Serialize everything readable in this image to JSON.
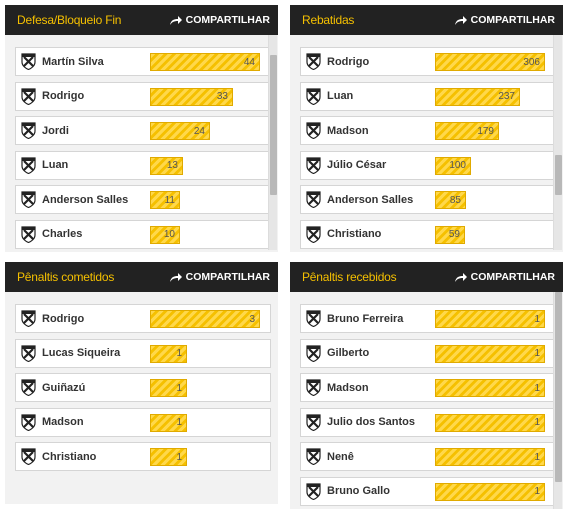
{
  "share_label": "COMPARTILHAR",
  "accent_color": "#f5c000",
  "icons": {
    "share": "share-arrow-icon",
    "crest": "vasco-crest-icon"
  },
  "panels": [
    {
      "title": "Defesa/Bloqueio Fin",
      "max": 44,
      "rows": [
        {
          "name": "Martín Silva",
          "value": 44
        },
        {
          "name": "Rodrigo",
          "value": 33
        },
        {
          "name": "Jordi",
          "value": 24
        },
        {
          "name": "Luan",
          "value": 13
        },
        {
          "name": "Anderson Salles",
          "value": 11
        },
        {
          "name": "Charles",
          "value": 10
        }
      ]
    },
    {
      "title": "Rebatidas",
      "max": 306,
      "rows": [
        {
          "name": "Rodrigo",
          "value": 306
        },
        {
          "name": "Luan",
          "value": 237
        },
        {
          "name": "Madson",
          "value": 179
        },
        {
          "name": "Júlio César",
          "value": 100
        },
        {
          "name": "Anderson Salles",
          "value": 85
        },
        {
          "name": "Christiano",
          "value": 59
        }
      ]
    },
    {
      "title": "Pênaltis cometidos",
      "max": 3,
      "rows": [
        {
          "name": "Rodrigo",
          "value": 3
        },
        {
          "name": "Lucas Siqueira",
          "value": 1
        },
        {
          "name": "Guiñazú",
          "value": 1
        },
        {
          "name": "Madson",
          "value": 1
        },
        {
          "name": "Christiano",
          "value": 1
        }
      ]
    },
    {
      "title": "Pênaltis recebidos",
      "max": 1,
      "rows": [
        {
          "name": "Bruno Ferreira",
          "value": 1
        },
        {
          "name": "Gilberto",
          "value": 1
        },
        {
          "name": "Madson",
          "value": 1
        },
        {
          "name": "Julio dos Santos",
          "value": 1
        },
        {
          "name": "Nenê",
          "value": 1
        },
        {
          "name": "Bruno Gallo",
          "value": 1
        }
      ]
    }
  ]
}
